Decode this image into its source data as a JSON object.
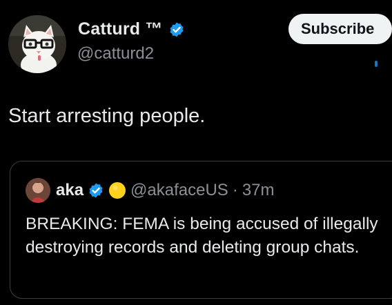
{
  "author": {
    "display_name": "Catturd ™",
    "handle": "@catturd2",
    "avatar_icon": "cat-with-glasses-avatar",
    "verified_icon": "verified-badge-icon"
  },
  "subscribe_button": {
    "label": "Subscribe"
  },
  "tweet": {
    "text": "Start arresting people."
  },
  "quoted_tweet": {
    "display_name": "aka",
    "handle": "@akafaceUS",
    "separator": "·",
    "time": "37m",
    "text": "BREAKING: FEMA is being accused of illegally destroying records and deleting group chats.",
    "avatar_icon": "user-avatar",
    "verified_icon": "verified-badge-icon",
    "badge_icon": "yellow-circle-badge-icon"
  },
  "colors": {
    "background": "#000000",
    "text_primary": "#e7e9ea",
    "text_secondary": "#8b9096",
    "verified_blue": "#1d9bf0",
    "button_bg": "#eff3f4",
    "badge_yellow": "#ffd21f"
  }
}
